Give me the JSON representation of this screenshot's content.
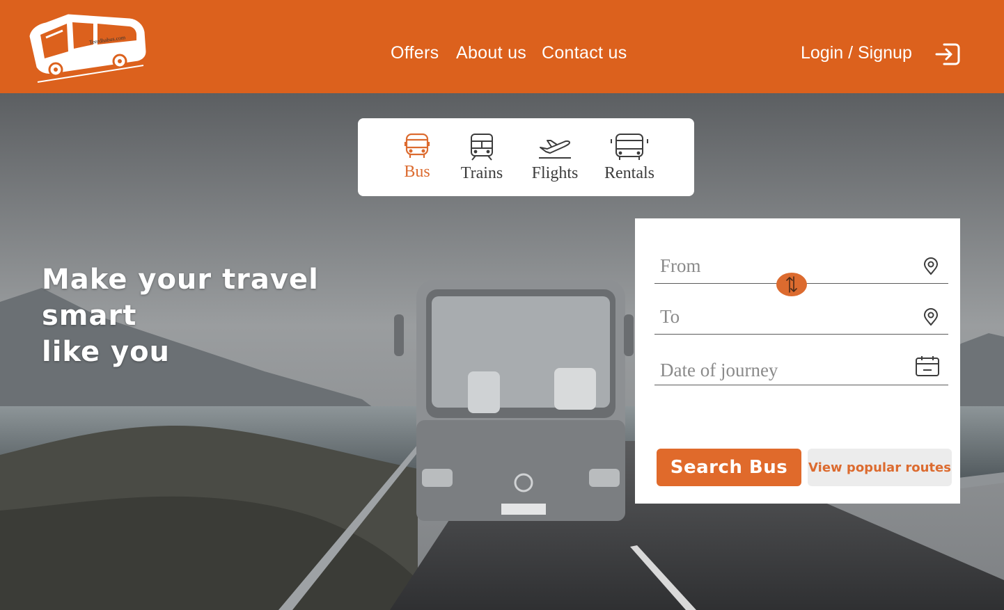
{
  "brand": {
    "logo_text": "Teerdhabus.com",
    "accent": "#dc611d"
  },
  "nav": {
    "offers": "Offers",
    "about": "About us",
    "contact": "Contact us",
    "login": "Login / Signup",
    "login_icon": "login-arrow-icon"
  },
  "hero": {
    "headline_line1": "Make your travel smart",
    "headline_line2": "like you"
  },
  "modes": [
    {
      "label": "Bus",
      "icon": "bus-icon",
      "active": true
    },
    {
      "label": "Trains",
      "icon": "train-icon",
      "active": false
    },
    {
      "label": "Flights",
      "icon": "plane-icon",
      "active": false
    },
    {
      "label": "Rentals",
      "icon": "rental-van-icon",
      "active": false
    }
  ],
  "search": {
    "from_placeholder": "From",
    "to_placeholder": "To",
    "date_placeholder": "Date of journey",
    "search_button": "Search Bus",
    "popular_button": "View popular routes"
  }
}
